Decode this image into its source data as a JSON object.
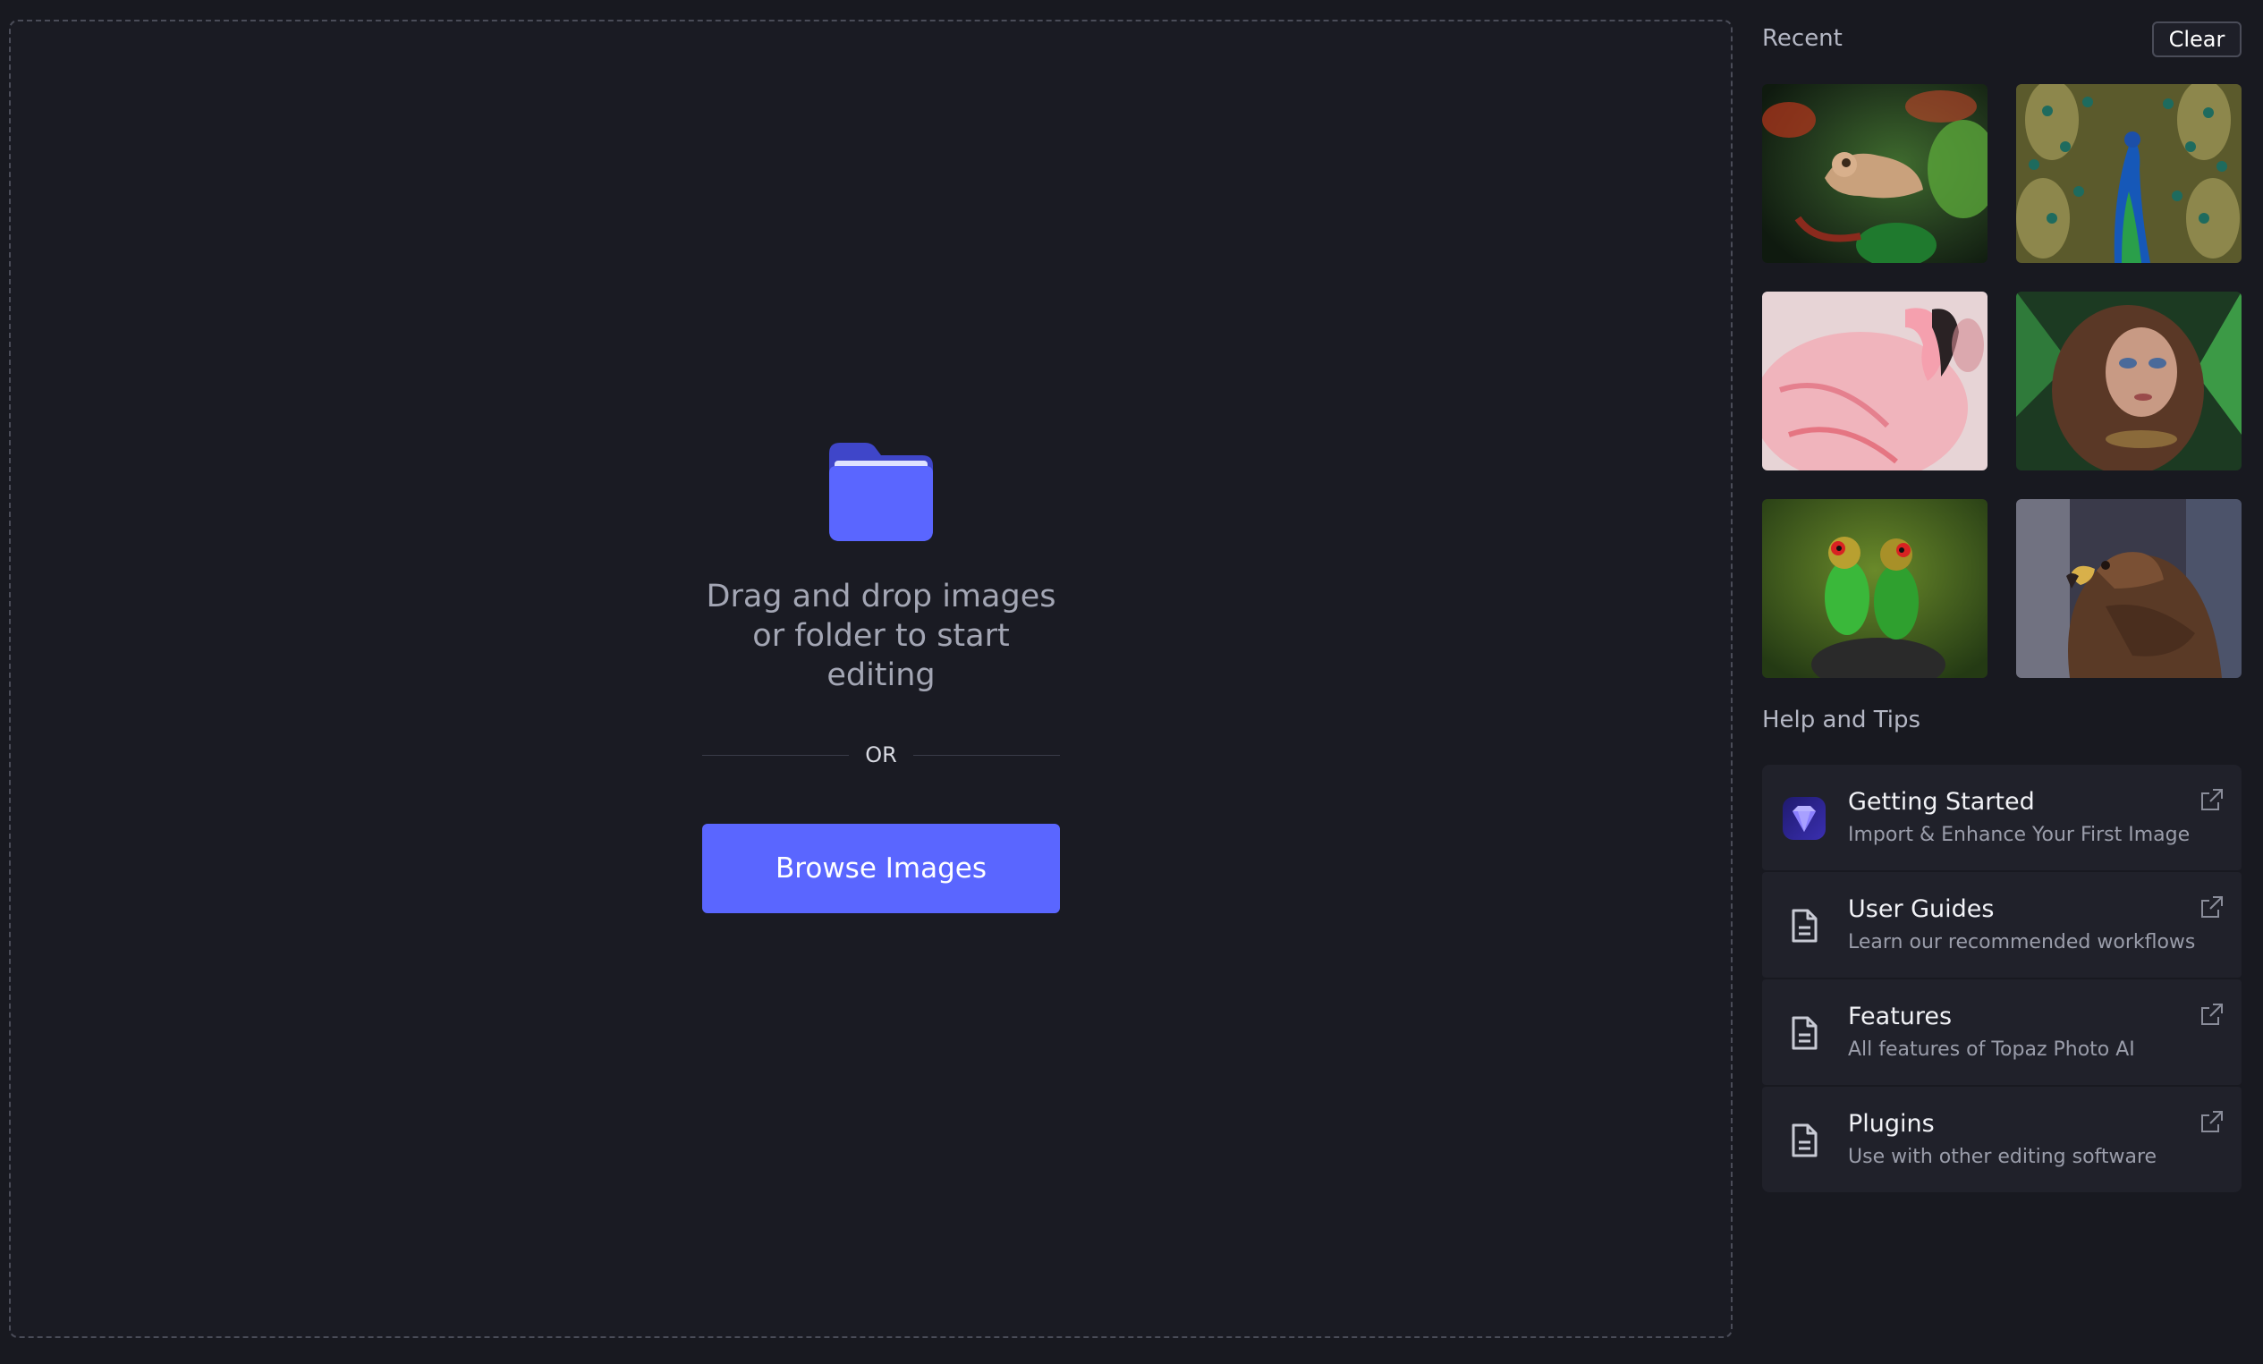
{
  "dropzone": {
    "message": "Drag and drop images or folder to start editing",
    "or_label": "OR",
    "browse_label": "Browse Images"
  },
  "sidebar": {
    "recent_title": "Recent",
    "clear_label": "Clear",
    "recent_images": [
      {
        "subject": "chameleon"
      },
      {
        "subject": "peacock"
      },
      {
        "subject": "flamingo"
      },
      {
        "subject": "woman-portrait"
      },
      {
        "subject": "lovebirds"
      },
      {
        "subject": "eagle"
      }
    ],
    "help_title": "Help and Tips",
    "help_items": [
      {
        "title": "Getting Started",
        "subtitle": "Import & Enhance Your First Image",
        "icon": "topaz-logo-icon"
      },
      {
        "title": "User Guides",
        "subtitle": "Learn our recommended workflows",
        "icon": "document-icon"
      },
      {
        "title": "Features",
        "subtitle": "All features of Topaz Photo AI",
        "icon": "document-icon"
      },
      {
        "title": "Plugins",
        "subtitle": "Use with other editing software",
        "icon": "document-icon"
      }
    ]
  },
  "colors": {
    "background": "#181920",
    "accent": "#5a66ff",
    "panel": "#20212a"
  }
}
